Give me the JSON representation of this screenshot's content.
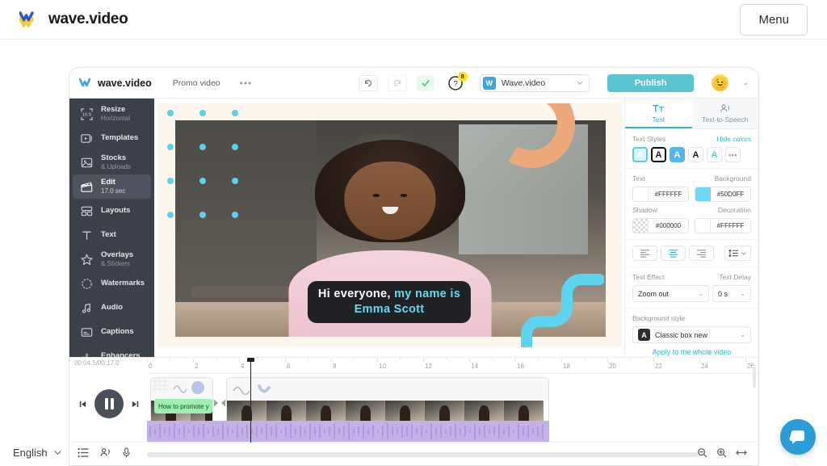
{
  "site_header": {
    "brand_name": "wave.video",
    "menu_label": "Menu",
    "logo_colors": {
      "top": "#2b59c3",
      "bottom": "#f2cb36"
    }
  },
  "editor": {
    "topbar": {
      "logo_text": "wave.video",
      "project_name": "Promo video",
      "more_label": "•••",
      "undo_label": "undo",
      "redo_label": "redo",
      "saved_label": "saved",
      "help_badge": "8",
      "brand_chip": "W",
      "brand_label": "Wave.video",
      "publish_label": "Publish",
      "avatar_emoji": "😉",
      "chevron": "⌄",
      "accent_color": "#5bc4d1"
    },
    "sidebar": {
      "items": [
        {
          "label": "Resize",
          "sub": "Horizontal",
          "icon": "resize-icon",
          "active": false
        },
        {
          "label": "Templates",
          "sub": "",
          "icon": "templates-icon",
          "active": false
        },
        {
          "label": "Stocks",
          "sub": "& Uploads",
          "icon": "stocks-icon",
          "active": false
        },
        {
          "label": "Edit",
          "sub": "17.0 sec",
          "icon": "edit-clapper-icon",
          "active": true
        },
        {
          "label": "Layouts",
          "sub": "",
          "icon": "layouts-icon",
          "active": false
        },
        {
          "label": "Text",
          "sub": "",
          "icon": "text-icon",
          "active": false
        },
        {
          "label": "Overlays",
          "sub": "& Stickers",
          "icon": "star-icon",
          "active": false
        },
        {
          "label": "Watermarks",
          "sub": "",
          "icon": "watermark-icon",
          "active": false
        },
        {
          "label": "Audio",
          "sub": "",
          "icon": "audio-note-icon",
          "active": false
        },
        {
          "label": "Captions",
          "sub": "",
          "icon": "captions-icon",
          "active": false
        },
        {
          "label": "Enhancers",
          "sub": "",
          "icon": "enhancers-icon",
          "active": false
        }
      ]
    },
    "canvas": {
      "caption_line1_plain": "Hi everyone,",
      "caption_line1_highlight": " my name is",
      "caption_line2": "Emma Scott",
      "caption_highlight_color": "#63d9f0",
      "caption_bg": "#1f2125",
      "dot_color": "#5ed0f0",
      "arc_color": "#eda97c",
      "wave_color": "#5ed5ee"
    },
    "right_panel": {
      "tabs": [
        {
          "label": "Text",
          "icon": "text-tt-icon",
          "active": true
        },
        {
          "label": "Text-to-Speech",
          "icon": "speech-icon",
          "active": false
        }
      ],
      "text_styles_label": "Text Styles",
      "hide_colors_label": "Hide colors",
      "style_swatches": [
        "A",
        "A",
        "A",
        "A",
        "A",
        "•••"
      ],
      "text_label": "Text",
      "text_color": "#FFFFFF",
      "background_label": "Background",
      "background_color": "#50D0FF",
      "shadow_label": "Shadow",
      "shadow_color": "#000000",
      "decoration_label": "Decoration",
      "decoration_color": "#FFFFFF",
      "align_options": [
        "left",
        "center",
        "right"
      ],
      "align_active": "center",
      "line_spacing_icon": "line-spacing-icon",
      "text_effect_label": "Text Effect",
      "text_effect_value": "Zoom out",
      "text_delay_label": "Text Delay",
      "text_delay_value": "0 s",
      "background_style_label": "Background style",
      "background_style_value": "Classic box new",
      "background_style_chip": "A",
      "apply_whole_video_label": "Apply to the whole video"
    },
    "timeline": {
      "current_time": "00:04.5",
      "total_time": "/00:17.0",
      "ruler_ticks": [
        0,
        2,
        4,
        6,
        8,
        10,
        12,
        14,
        16,
        18,
        20,
        22,
        24,
        26
      ],
      "playhead_seconds": 4.5,
      "clip1_label": "How to promote y",
      "clip1_label_bg": "#9ef0b2",
      "audio_track_color": "#c3b2e8",
      "transport": {
        "prev_icon": "skip-previous-icon",
        "play_state": "pause",
        "next_icon": "skip-next-icon"
      },
      "bottom_icons": [
        "layers-icon",
        "text-to-speech-icon",
        "microphone-icon"
      ],
      "zoom_icons": [
        "zoom-out-icon",
        "zoom-in-icon",
        "fit-width-icon"
      ]
    }
  },
  "footer": {
    "language_label": "English",
    "language_chevron": "⌄",
    "chat_icon": "chat-bubble-icon"
  }
}
